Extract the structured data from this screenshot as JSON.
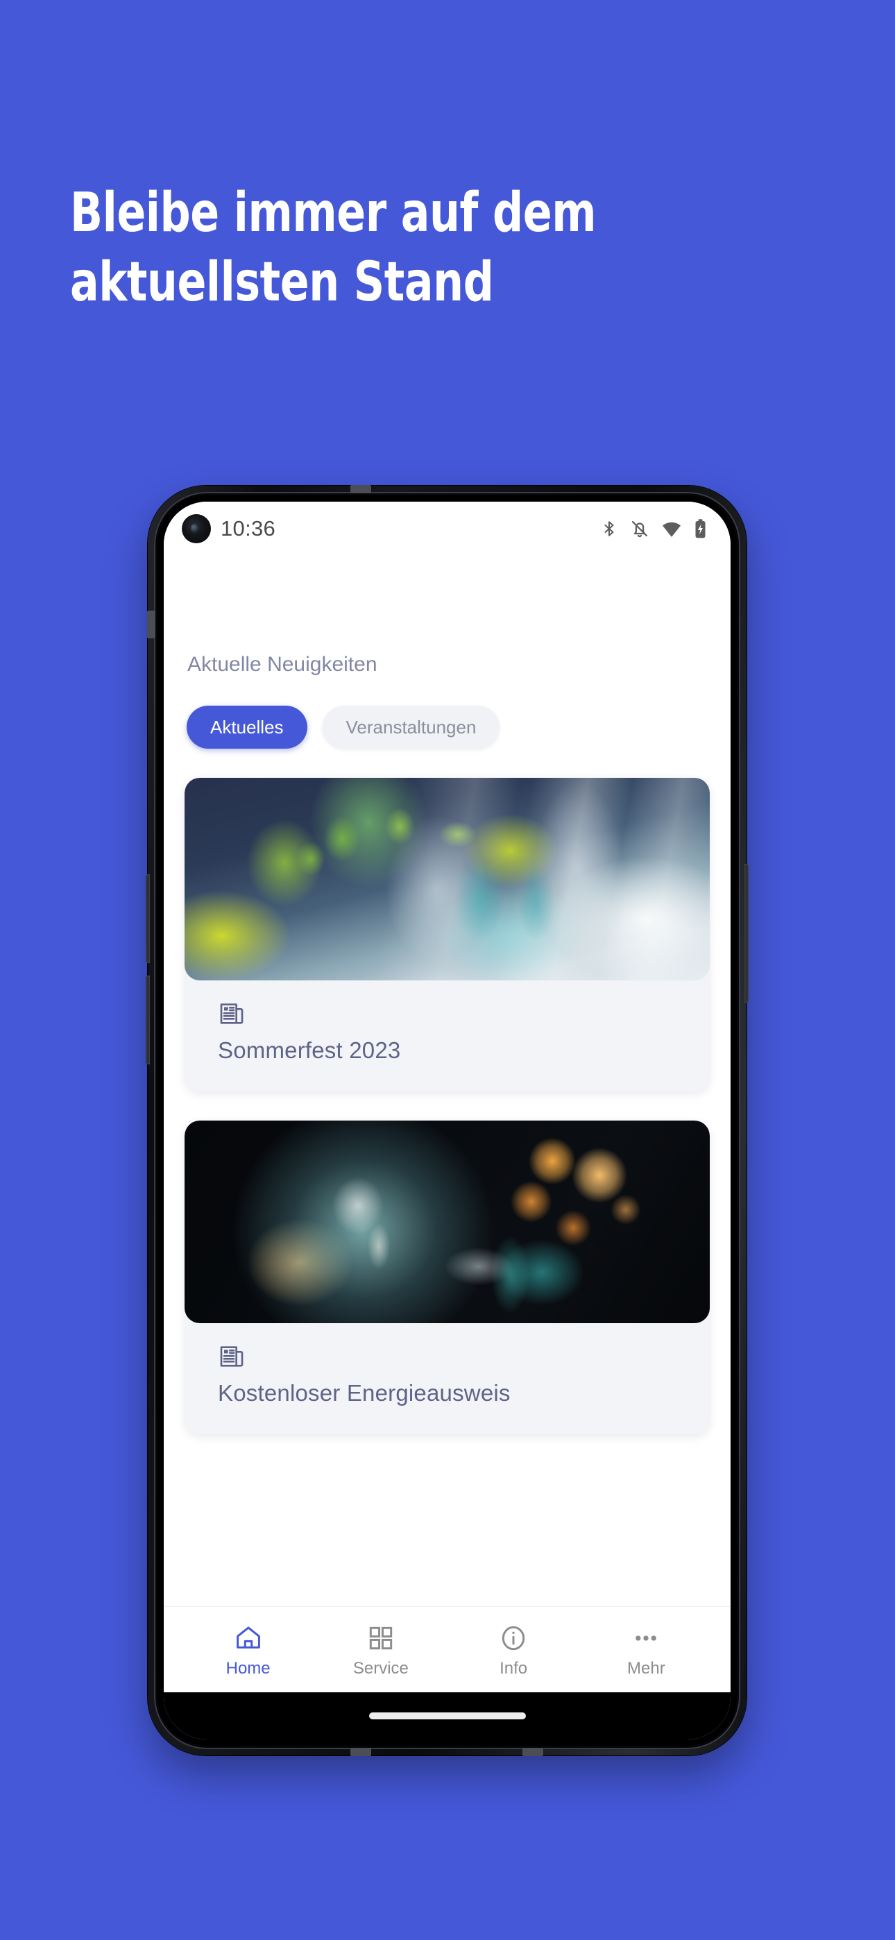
{
  "promo": {
    "headline": "Bleibe immer auf dem\naktuellsten Stand",
    "background_color": "#4558D8",
    "text_color": "#FFFFFF"
  },
  "phone": {
    "statusbar": {
      "time": "10:36",
      "icons": [
        "bluetooth-icon",
        "bell-off-icon",
        "wifi-icon",
        "battery-charging-icon"
      ],
      "camera": "front-camera-punch-hole"
    },
    "home_indicator": "home-indicator-pill",
    "hardware_buttons": [
      "volume-up-button",
      "volume-down-button",
      "power-button"
    ]
  },
  "app": {
    "section_title": "Aktuelle Neuigkeiten",
    "accent_color": "#4558D8",
    "muted_text_color": "#8287A3",
    "chips": [
      {
        "label": "Aktuelles",
        "active": true
      },
      {
        "label": "Veranstaltungen",
        "active": false
      }
    ],
    "news_cards": [
      {
        "title": "Sommerfest 2023",
        "icon": "newspaper-icon",
        "image": "festive-table-setting-photo"
      },
      {
        "title": "Kostenloser Energieausweis",
        "icon": "newspaper-icon",
        "image": "light-bulb-bokeh-photo"
      }
    ],
    "bottom_nav": [
      {
        "label": "Home",
        "icon": "home-icon",
        "active": true
      },
      {
        "label": "Service",
        "icon": "grid-icon",
        "active": false
      },
      {
        "label": "Info",
        "icon": "info-icon",
        "active": false
      },
      {
        "label": "Mehr",
        "icon": "ellipsis-icon",
        "active": false
      }
    ]
  }
}
